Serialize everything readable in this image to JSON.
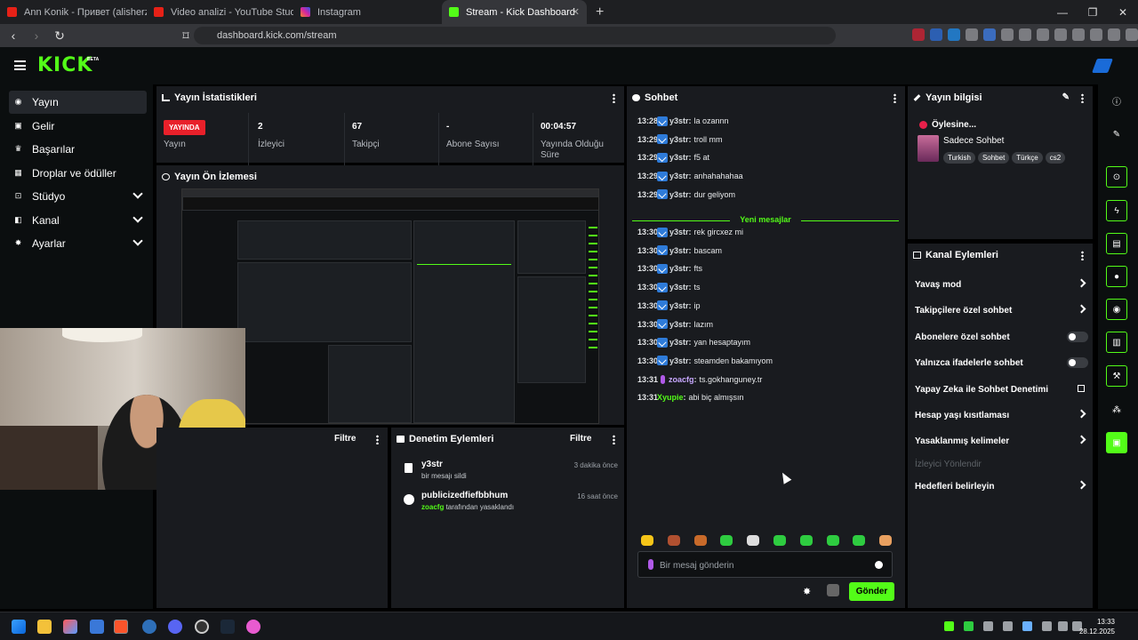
{
  "browser": {
    "tabs": [
      {
        "title": "Ann Konik - Привет (alisherzak R",
        "color": "#e62117"
      },
      {
        "title": "Video analizi - YouTube Studio",
        "color": "#e62117"
      },
      {
        "title": "Instagram",
        "color": "#d6249f"
      },
      {
        "title": "Stream - Kick Dashboard",
        "color": "#53fc18",
        "active": true
      }
    ],
    "url": "dashboard.kick.com/stream"
  },
  "app": {
    "logo": "KICK",
    "beta": "BETA"
  },
  "sidebar": {
    "items": [
      {
        "label": "Yayın",
        "icon": "broadcast-icon"
      },
      {
        "label": "Gelir",
        "icon": "money-icon"
      },
      {
        "label": "Başarılar",
        "icon": "trophy-icon"
      },
      {
        "label": "Droplar ve ödüller",
        "icon": "gift-icon"
      },
      {
        "label": "Stüdyo",
        "icon": "studio-icon"
      },
      {
        "label": "Kanal",
        "icon": "channel-icon"
      },
      {
        "label": "Ayarlar",
        "icon": "gear-icon"
      }
    ]
  },
  "stats": {
    "title": "Yayın İstatistikleri",
    "live_badge": "YAYINDA",
    "items": [
      {
        "value": "",
        "label": "Yayın"
      },
      {
        "value": "2",
        "label": "İzleyici"
      },
      {
        "value": "67",
        "label": "Takipçi"
      },
      {
        "value": "-",
        "label": "Abone Sayısı"
      },
      {
        "value": "00:04:57",
        "label": "Yayında Olduğu Süre"
      }
    ]
  },
  "preview": {
    "title": "Yayın Ön İzlemesi"
  },
  "left_filter": {
    "filter": "Filtre"
  },
  "moderation": {
    "title": "Denetim Eylemleri",
    "filter": "Filtre",
    "rows": [
      {
        "user": "y3str",
        "desc": "bir mesajı sildi",
        "time": "3 dakika önce"
      },
      {
        "user": "publicizedfiefbbhum",
        "by": "zoacfg",
        "desc": " tarafından yasaklandı",
        "time": "16 saat önce"
      }
    ]
  },
  "chat": {
    "title": "Sohbet",
    "messages_before": [
      {
        "time": "13:28",
        "user": "y3str",
        "text": "la ozannn"
      },
      {
        "time": "13:29",
        "user": "y3str",
        "text": "troll mm"
      },
      {
        "time": "13:29",
        "user": "y3str",
        "text": "f5 at"
      },
      {
        "time": "13:29",
        "user": "y3str",
        "text": "anhahahahaa"
      },
      {
        "time": "13:29",
        "user": "y3str",
        "text": "dur geliyom"
      }
    ],
    "new_messages_label": "Yeni mesajlar",
    "messages_after": [
      {
        "time": "13:30",
        "user": "y3str",
        "text": "rek gircxez mi"
      },
      {
        "time": "13:30",
        "user": "y3str",
        "text": "bascam"
      },
      {
        "time": "13:30",
        "user": "y3str",
        "text": "fts"
      },
      {
        "time": "13:30",
        "user": "y3str",
        "text": "ts"
      },
      {
        "time": "13:30",
        "user": "y3str",
        "text": "ip"
      },
      {
        "time": "13:30",
        "user": "y3str",
        "text": "lazım"
      },
      {
        "time": "13:30",
        "user": "y3str",
        "text": "yan hesaptayım"
      },
      {
        "time": "13:30",
        "user": "y3str",
        "text": "steamden bakamıyom"
      },
      {
        "time": "13:31",
        "user": "zoacfg",
        "text": "ts.gokhanguney.tr",
        "mic": true
      },
      {
        "time": "13:31",
        "user": "Xyupie",
        "text": "abi biç almışsın",
        "plain": true
      }
    ],
    "input_placeholder": "Bir mesaj gönderin",
    "send_label": "Gönder"
  },
  "stream_info": {
    "title": "Yayın bilgisi",
    "status": "Öylesine...",
    "category": "Sadece Sohbet",
    "tags": [
      "Turkish",
      "Sohbet",
      "Türkçe",
      "cs2"
    ]
  },
  "channel_actions": {
    "title": "Kanal Eylemleri",
    "items": [
      {
        "label": "Yavaş mod",
        "type": "chevron"
      },
      {
        "label": "Takipçilere özel sohbet",
        "type": "chevron"
      },
      {
        "label": "Abonelere özel sohbet",
        "type": "toggle"
      },
      {
        "label": "Yalnızca ifadelerle sohbet",
        "type": "toggle"
      },
      {
        "label": "Yapay Zeka ile Sohbet Denetimi",
        "type": "external"
      },
      {
        "label": "Hesap yaşı kısıtlaması",
        "type": "chevron"
      },
      {
        "label": "Yasaklanmış kelimeler",
        "type": "chevron"
      },
      {
        "label": "İzleyici Yönlendir",
        "type": "disabled"
      },
      {
        "label": "Hedefleri belirleyin",
        "type": "chevron"
      }
    ]
  },
  "clock": {
    "time": "13:33",
    "date": "28.12.2025"
  }
}
